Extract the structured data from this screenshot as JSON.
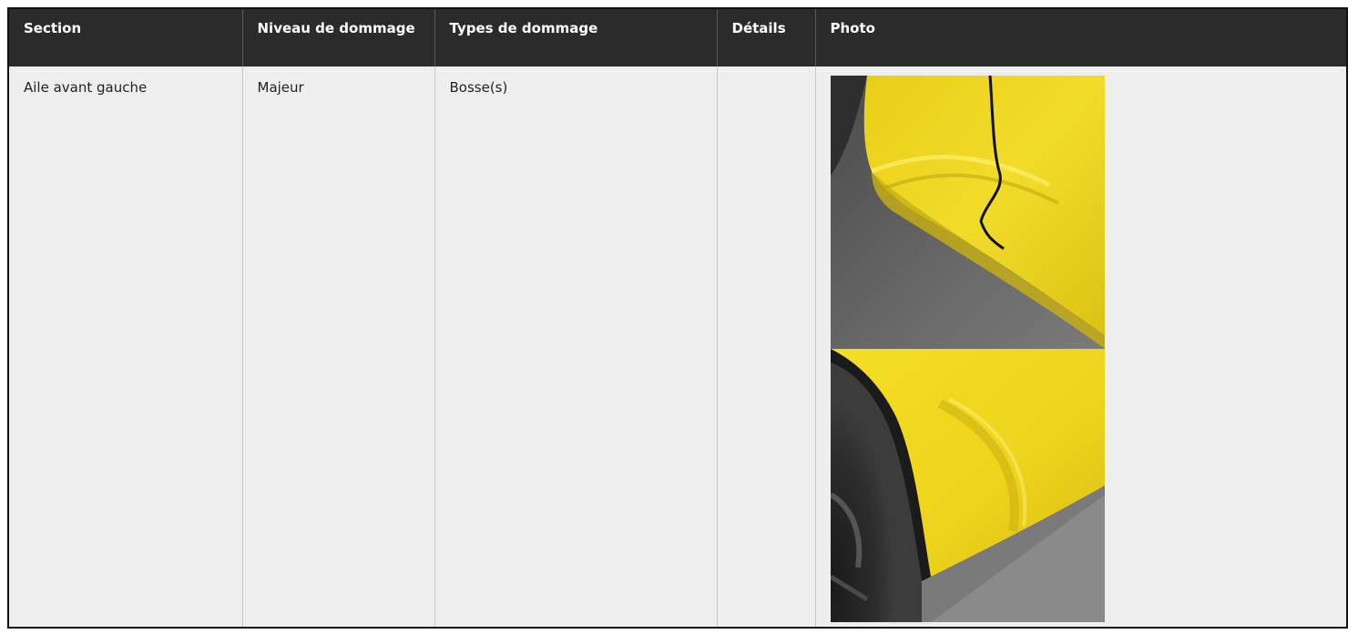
{
  "table": {
    "headers": [
      "Section",
      "Niveau de dommage",
      "Types de dommage",
      "Détails",
      "Photo"
    ],
    "rows": [
      {
        "section": "Aile avant gauche",
        "niveau": "Majeur",
        "types": "Bosse(s)",
        "details": "",
        "photos": [
          "yellow-car-dent-photo-1",
          "yellow-car-dent-photo-2"
        ]
      }
    ]
  },
  "colors": {
    "header_bg": "#2b2b2b",
    "header_text": "#ffffff",
    "body_bg": "#eeeeee",
    "car_paint": "#f0d81c",
    "asphalt": "#6e6e6e"
  }
}
